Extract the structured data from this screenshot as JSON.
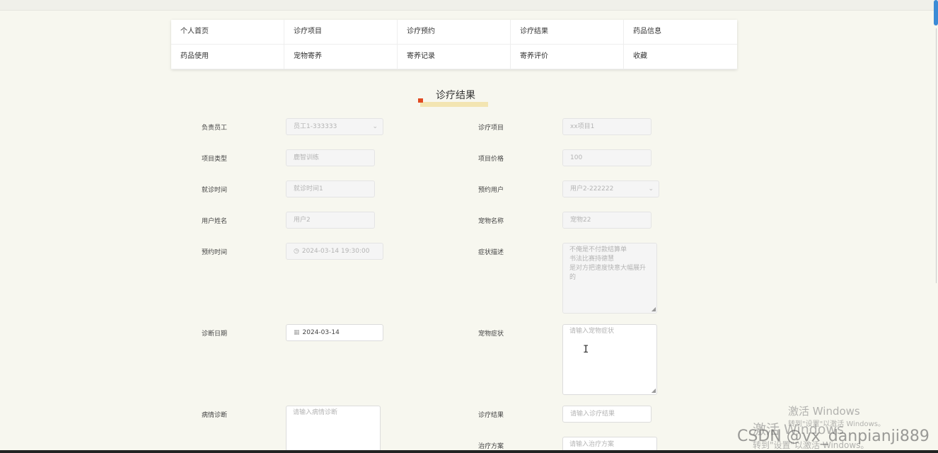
{
  "nav": {
    "items": [
      "个人首页",
      "诊疗项目",
      "诊疗预约",
      "诊疗结果",
      "药品信息",
      "药品使用",
      "宠物寄养",
      "寄养记录",
      "寄养评价",
      "收藏"
    ]
  },
  "page": {
    "title": "诊疗结果"
  },
  "form": {
    "staff": {
      "label": "负责员工",
      "value": "员工1-333333"
    },
    "project": {
      "label": "诊疗项目",
      "value": "xx项目1"
    },
    "project_type": {
      "label": "项目类型",
      "value": "鹿智训练"
    },
    "project_price": {
      "label": "项目价格",
      "value": "100"
    },
    "visit_time": {
      "label": "就诊时间",
      "value": "就诊时间1"
    },
    "booking_user": {
      "label": "预约用户",
      "value": "用户2-222222"
    },
    "user_name": {
      "label": "用户姓名",
      "value": "用户2"
    },
    "pet_name": {
      "label": "宠物名称",
      "value": "宠物22"
    },
    "booking_time": {
      "label": "预约时间",
      "value": "2024-03-14 19:30:00"
    },
    "symptom_desc": {
      "label": "症状描述",
      "lines": [
        "不俺是不付款结算单",
        "书法比赛持德慧",
        "是对方把速度快意大幅展升",
        "的"
      ]
    },
    "diagnosis_date": {
      "label": "诊断日期",
      "value": "2024-03-14"
    },
    "pet_symptom": {
      "label": "宠物症状",
      "placeholder": "请输入宠物症状"
    },
    "disease_diag": {
      "label": "病情诊断",
      "placeholder": "请输入病情诊断"
    },
    "treat_result": {
      "label": "诊疗结果",
      "placeholder": "请输入诊疗结果"
    },
    "treat_plan": {
      "label": "治疗方案",
      "placeholder": "请输入治疗方案"
    }
  },
  "watermark": {
    "activate1": "激活 Windows",
    "activate1_sub": "转到\"设置\"以激活 Windows。",
    "activate2": "激活 Windows",
    "activate2_sub": "转到\"设置\"以激活 Windows。",
    "csdn": "CSDN @vx_danpianji889"
  },
  "icons": {
    "select": "chevron-down-icon",
    "time": "clock-icon",
    "date": "calendar-icon"
  }
}
